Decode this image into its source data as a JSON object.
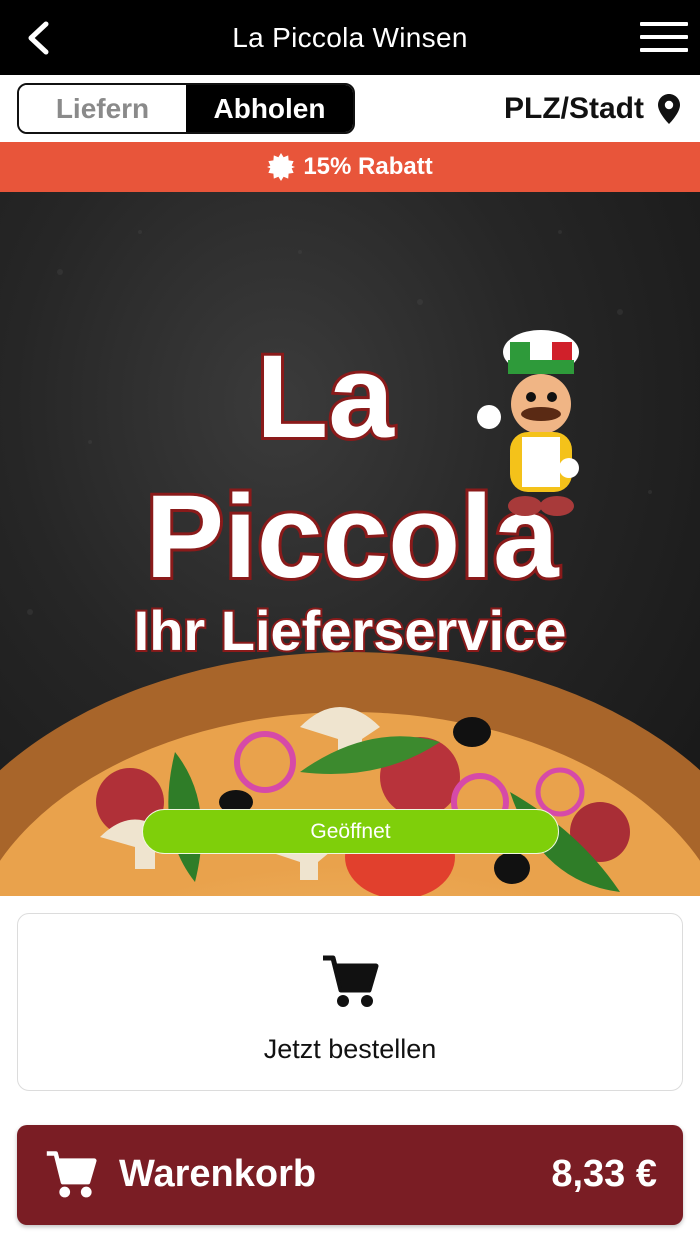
{
  "header": {
    "title": "La Piccola Winsen",
    "back_icon": "chevron-left-icon",
    "menu_icon": "hamburger-menu-icon"
  },
  "mode_toggle": {
    "options": [
      "Liefern",
      "Abholen"
    ],
    "selected": "Abholen"
  },
  "location": {
    "label": "PLZ/Stadt",
    "icon": "map-pin-icon"
  },
  "promo": {
    "text": "15% Rabatt",
    "icon": "badge-icon",
    "color": "#e8553a"
  },
  "hero": {
    "logo_line1": "La",
    "logo_line2": "Piccola",
    "tagline": "Ihr Lieferservice",
    "status": "Geöffnet",
    "status_color": "#7fcf0a"
  },
  "order_card": {
    "icon": "shopping-cart-icon",
    "label": "Jetzt bestellen"
  },
  "cart_bar": {
    "icon": "shopping-cart-icon",
    "label": "Warenkorb",
    "total": "8,33 €",
    "color": "#7a1d24"
  }
}
